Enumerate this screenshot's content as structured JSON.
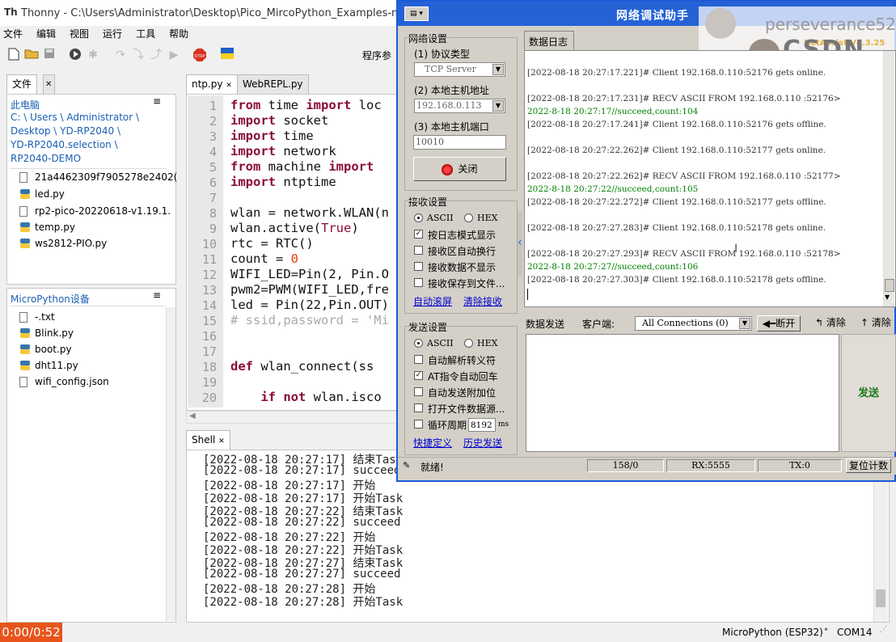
{
  "thonny": {
    "title": "Thonny  -  C:\\Users\\Administrator\\Desktop\\Pico_MircoPython_Examples-main\\E",
    "menu": [
      "文件",
      "编辑",
      "视图",
      "运行",
      "工具",
      "帮助"
    ],
    "toolbar_partial_label": "程序参",
    "files_tab": "文件",
    "this_pc_label": "此电脑",
    "path_lines": [
      "C: \\ Users \\ Administrator \\",
      "Desktop \\ YD-RP2040 \\",
      "YD-RP2040.selection \\",
      "RP2040-DEMO"
    ],
    "local_files": [
      "21a4462309f7905278e2402(",
      "led.py",
      "rp2-pico-20220618-v1.19.1.",
      "temp.py",
      "ws2812-PIO.py"
    ],
    "device_label": "MicroPython设备",
    "device_files": [
      "-.txt",
      "Blink.py",
      "boot.py",
      "dht11.py",
      "wifi_config.json"
    ],
    "editor_tabs": [
      "ntp.py",
      "WebREPL.py"
    ],
    "code_lines": [
      "from time import loc",
      "import socket",
      "import time",
      "import network",
      "from machine import",
      "import ntptime",
      "",
      "wlan = network.WLAN(n",
      "wlan.active(True)",
      "rtc = RTC()",
      "count = 0",
      "WIFI_LED=Pin(2, Pin.O",
      "pwm2=PWM(WIFI_LED,fre",
      "led = Pin(22,Pin.OUT)",
      "# ssid,password = 'Mi",
      "",
      "",
      "def wlan_connect(ss",
      "",
      "    if not wlan.isco"
    ],
    "line_numbers": [
      "1",
      "2",
      "3",
      "4",
      "5",
      "6",
      "7",
      "8",
      "9",
      "10",
      "11",
      "12",
      "13",
      "14",
      "15",
      "16",
      "17",
      "18",
      "19",
      "20"
    ],
    "shell_tab": "Shell",
    "shell_lines": [
      "[2022-08-18 20:27:17] 结束Task",
      "[2022-08-18 20:27:17] succeed",
      "[2022-08-18 20:27:17] 开始",
      "[2022-08-18 20:27:17] 开始Task",
      "[2022-08-18 20:27:22] 结束Task",
      "[2022-08-18 20:27:22] succeed",
      "[2022-08-18 20:27:22] 开始",
      "[2022-08-18 20:27:22] 开始Task",
      "[2022-08-18 20:27:27] 结束Task",
      "[2022-08-18 20:27:27] succeed",
      "[2022-08-18 20:27:28] 开始",
      "[2022-08-18 20:27:28] 开始Task"
    ],
    "interpreter": "MicroPython (ESP32)",
    "port": "COM14",
    "video_timer": "0:00/0:52"
  },
  "netassist": {
    "title": "网络调试助手",
    "watermark_text": "perseverance52",
    "version_text": "NetAssist V4.3.25",
    "csdn": "CSDN",
    "net_settings": "网络设置",
    "protocol_label": "(1) 协议类型",
    "protocol_value": "TCP Server",
    "host_label": "(2) 本地主机地址",
    "host_value": "192.168.0.113",
    "port_label": "(3) 本地主机端口",
    "port_value": "10010",
    "close_button": "关闭",
    "recv_settings": "接收设置",
    "recv_ascii": "ASCII",
    "recv_hex": "HEX",
    "recv_opts": [
      "按日志模式显示",
      "接收区自动换行",
      "接收数据不显示",
      "接收保存到文件..."
    ],
    "auto_scroll": "自动滚屏",
    "clear_recv": "清除接收",
    "send_settings": "发送设置",
    "send_ascii": "ASCII",
    "send_hex": "HEX",
    "send_opts": [
      "自动解析转义符",
      "AT指令自动回车",
      "自动发送附加位",
      "打开文件数据源..."
    ],
    "loop_label": "循环周期",
    "loop_value": "8192",
    "loop_unit": "ms",
    "shortcut": "快捷定义",
    "history": "历史发送",
    "data_log_tab": "数据日志",
    "log_lines": [
      {
        "t": "[2022-08-18 20:27:17.221]# Client 192.168.0.110:52176 gets online.",
        "c": "n"
      },
      {
        "t": "[2022-08-18 20:27:17.231]# RECV ASCII FROM 192.168.0.110 :52176>",
        "c": "n"
      },
      {
        "t": "2022-8-18 20:27:17//succeed,count:104",
        "c": "g"
      },
      {
        "t": "[2022-08-18 20:27:17.241]# Client 192.168.0.110:52176 gets offline.",
        "c": "n"
      },
      {
        "t": "[2022-08-18 20:27:22.262]# Client 192.168.0.110:52177 gets online.",
        "c": "n"
      },
      {
        "t": "[2022-08-18 20:27:22.262]# RECV ASCII FROM 192.168.0.110 :52177>",
        "c": "n"
      },
      {
        "t": "2022-8-18 20:27:22//succeed,count:105",
        "c": "g"
      },
      {
        "t": "[2022-08-18 20:27:22.272]# Client 192.168.0.110:52177 gets offline.",
        "c": "n"
      },
      {
        "t": "[2022-08-18 20:27:27.283]# Client 192.168.0.110:52178 gets online.",
        "c": "n"
      },
      {
        "t": "[2022-08-18 20:27:27.293]# RECV ASCII FROM 192.168.0.110 :52178>",
        "c": "n"
      },
      {
        "t": "2022-8-18 20:27:27//succeed,count:106",
        "c": "g"
      },
      {
        "t": "[2022-08-18 20:27:27.303]# Client 192.168.0.110:52178 gets offline.",
        "c": "n"
      }
    ],
    "send_tab": "数据发送",
    "client_label": "客户端:",
    "client_value": "All Connections (0)",
    "disconnect": "断开",
    "clear1": "清除",
    "clear2": "清除",
    "send_button": "发送",
    "status_ready": "就绪!",
    "status_count": "158/0",
    "status_rx": "RX:5555",
    "status_tx": "TX:0",
    "reset_count": "复位计数"
  }
}
